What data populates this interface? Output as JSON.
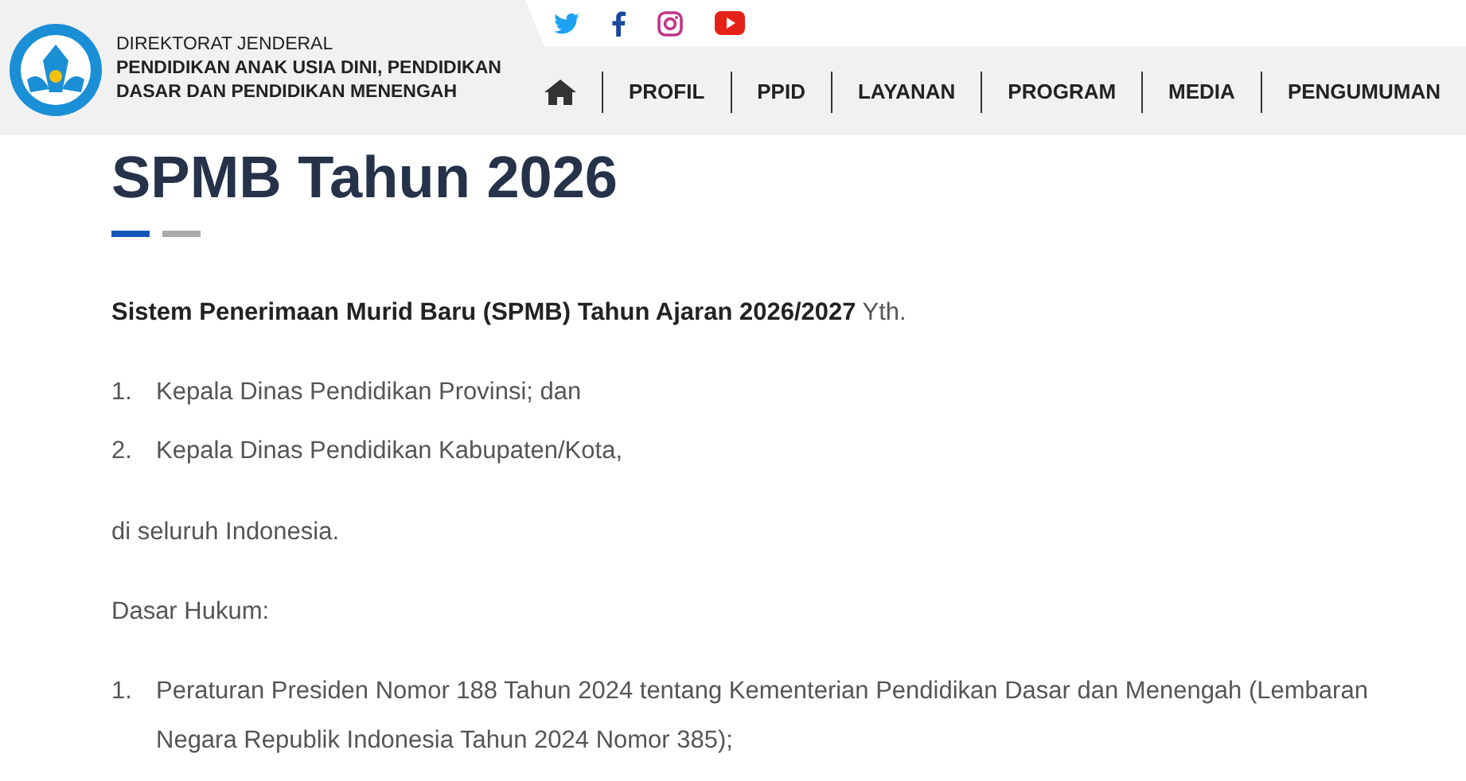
{
  "header": {
    "org_line1": "DIREKTORAT JENDERAL",
    "org_line2": "PENDIDIKAN ANAK USIA DINI, PENDIDIKAN",
    "org_line3": "DASAR DAN PENDIDIKAN MENENGAH"
  },
  "social": [
    {
      "kind": "twitter"
    },
    {
      "kind": "facebook"
    },
    {
      "kind": "instagram"
    },
    {
      "kind": "youtube"
    }
  ],
  "nav": [
    {
      "kind": "home"
    },
    {
      "kind": "text",
      "label": "PROFIL"
    },
    {
      "kind": "text",
      "label": "PPID"
    },
    {
      "kind": "text",
      "label": "LAYANAN"
    },
    {
      "kind": "text",
      "label": "PROGRAM"
    },
    {
      "kind": "text",
      "label": "MEDIA"
    },
    {
      "kind": "text",
      "label": "PENGUMUMAN"
    }
  ],
  "article": {
    "title": "SPMB Tahun 2026",
    "blocks": [
      {
        "kind": "para",
        "text": "**Sistem Penerimaan Murid Baru (SPMB) Tahun Ajaran 2026/2027** Yth."
      },
      {
        "kind": "list",
        "items": [
          {
            "number": "1.",
            "text": "Kepala Dinas Pendidikan Provinsi; dan"
          },
          {
            "number": "2.",
            "text": "Kepala Dinas Pendidikan Kabupaten/Kota,"
          }
        ]
      },
      {
        "kind": "para",
        "text": "di seluruh Indonesia."
      },
      {
        "kind": "para",
        "text": "Dasar Hukum:"
      },
      {
        "kind": "list",
        "items": [
          {
            "number": "1.",
            "text": "Peraturan Presiden Nomor 188 Tahun 2024 tentang Kementerian Pendidikan Dasar dan Menengah (Lembaran Negara Republik Indonesia Tahun 2024 Nomor 385);"
          }
        ]
      }
    ]
  }
}
